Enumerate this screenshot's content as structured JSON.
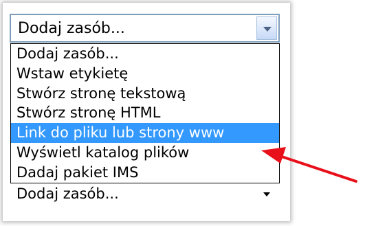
{
  "select": {
    "current_value": "Dodaj zasób...",
    "options": [
      {
        "label": "Dodaj zasób...",
        "selected": false
      },
      {
        "label": "Wstaw etykietę",
        "selected": false
      },
      {
        "label": "Stwórz stronę tekstową",
        "selected": false
      },
      {
        "label": "Stwórz stronę HTML",
        "selected": false
      },
      {
        "label": "Link do pliku lub strony www",
        "selected": true
      },
      {
        "label": "Wyświetl katalog plików",
        "selected": false
      },
      {
        "label": "Dadaj pakiet IMS",
        "selected": false
      }
    ],
    "highlight_color": "#3399ff"
  },
  "next_select": {
    "current_value": "Dodaj zasób..."
  },
  "annotation": {
    "arrow_color": "#e8101a",
    "arrow_icon": "red-arrow-icon"
  }
}
